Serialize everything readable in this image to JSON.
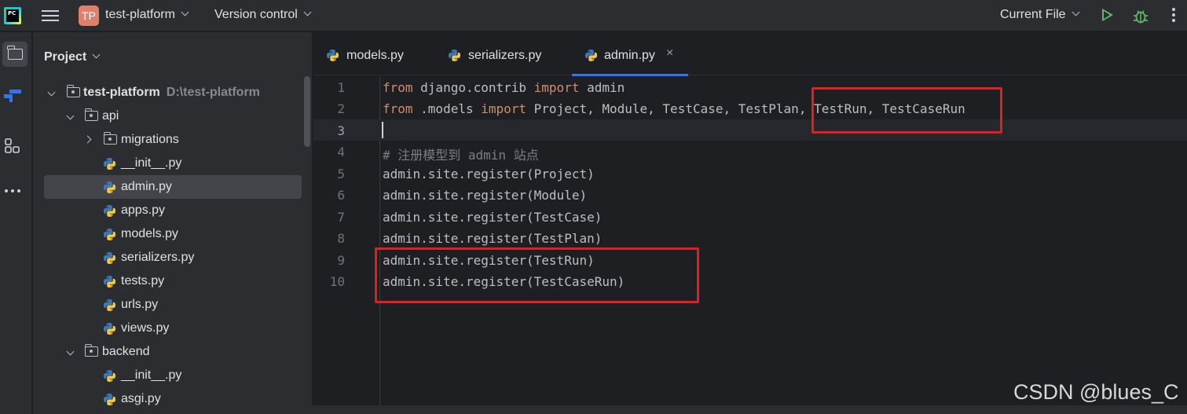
{
  "titlebar": {
    "project_badge": "TP",
    "project_name": "test-platform",
    "vcs_label": "Version control",
    "run_config": "Current File"
  },
  "project_panel": {
    "title": "Project",
    "tree": [
      {
        "label": "test-platform",
        "path": "D:\\test-platform",
        "type": "root"
      },
      {
        "label": "api",
        "type": "folder"
      },
      {
        "label": "migrations",
        "type": "folder"
      },
      {
        "label": "__init__.py",
        "type": "file"
      },
      {
        "label": "admin.py",
        "type": "file"
      },
      {
        "label": "apps.py",
        "type": "file"
      },
      {
        "label": "models.py",
        "type": "file"
      },
      {
        "label": "serializers.py",
        "type": "file"
      },
      {
        "label": "tests.py",
        "type": "file"
      },
      {
        "label": "urls.py",
        "type": "file"
      },
      {
        "label": "views.py",
        "type": "file"
      },
      {
        "label": "backend",
        "type": "folder"
      },
      {
        "label": "__init__.py",
        "type": "file"
      },
      {
        "label": "asgi.py",
        "type": "file"
      }
    ]
  },
  "tabs": [
    {
      "label": "models.py"
    },
    {
      "label": "serializers.py"
    },
    {
      "label": "admin.py",
      "close": "×"
    }
  ],
  "editor": {
    "line_numbers": [
      "1",
      "2",
      "3",
      "4",
      "5",
      "6",
      "7",
      "8",
      "9",
      "10"
    ],
    "lines": {
      "l1_kw1": "from",
      "l1_mod": " django.contrib ",
      "l1_kw2": "import",
      "l1_name": " admin",
      "l2_kw1": "from",
      "l2_mod": " .models ",
      "l2_kw2": "import",
      "l2_names": " Project, Module, TestCase, TestPlan, TestRun, TestCaseRun",
      "l4": "# 注册模型到 admin 站点",
      "l5": "admin.site.register(Project)",
      "l6": "admin.site.register(Module)",
      "l7": "admin.site.register(TestCase)",
      "l8": "admin.site.register(TestPlan)",
      "l9": "admin.site.register(TestRun)",
      "l10": "admin.site.register(TestCaseRun)"
    }
  },
  "watermark": "CSDN @blues_C",
  "colors": {
    "keyword": "#cf8e6d",
    "highlight_box": "#e02020",
    "tab_underline": "#3574f0"
  }
}
